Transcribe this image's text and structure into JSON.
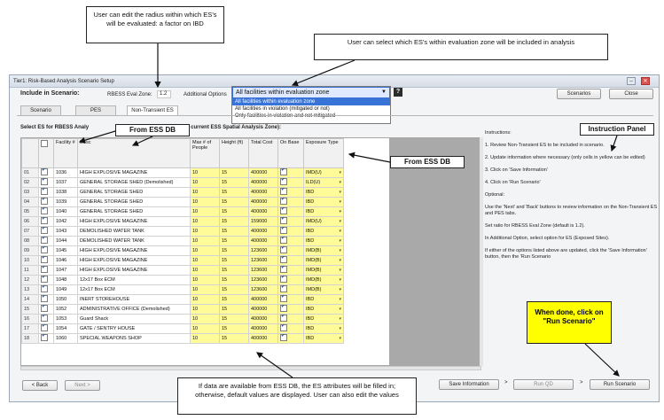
{
  "callouts": {
    "radius": "User can edit the radius within which ES's will be evaluated: a factor on IBD",
    "select_es": "User can select which ES's within evaluation zone will be included in analysis",
    "instruction_panel": "Instruction Panel",
    "from_ess_db_1": "From ESS DB",
    "from_ess_db_2": "From ESS DB",
    "defaults": "If data are available from ESS DB, the ES attributes will be filled in; otherwise, default values are displayed. User can also edit the values",
    "run": "When done, click on \"Run Scenario\""
  },
  "window": {
    "title": "Tier1: Risk-Based Analysis Scenario Setup",
    "include_label": "Include in Scenario:",
    "eval_zone_label": "RBESS Eval Zone:",
    "eval_zone_value": "1.2",
    "additional_options_label": "Additional Options",
    "help_icon": "?",
    "scenarios_button": "Scenarios",
    "close_button": "Close"
  },
  "dropdown": {
    "selected": "All facilities within evaluation zone",
    "options": [
      "All facilities within evaluation zone",
      "All facilities in violation (mitigated or not)",
      "Only facilities in violation and not mitigated"
    ]
  },
  "tabs": [
    "Scenario",
    "PES",
    "Non-Transient ES"
  ],
  "grid": {
    "select_text": "Select ES for RBESS Analy",
    "select_text_tail": "listed below from current ESS Spatial Analysis Zone):",
    "headers": [
      "",
      "Facility #",
      "Desc",
      "Max # of People",
      "Height (ft)",
      "Total Cost",
      "On Base",
      "Exposure Type"
    ],
    "rows": [
      {
        "n": "01",
        "fac": "1036",
        "desc": "HIGH EXPLOSIVE MAGAZINE",
        "people": "10",
        "height": "15",
        "cost": "400000",
        "exp": "IMD(U)"
      },
      {
        "n": "02",
        "fac": "1037",
        "desc": "GENERAL STORAGE SHED (Demolished)",
        "people": "10",
        "height": "15",
        "cost": "400000",
        "exp": "ILD(U)"
      },
      {
        "n": "03",
        "fac": "1038",
        "desc": "GENERAL STORAGE SHED",
        "people": "10",
        "height": "15",
        "cost": "400000",
        "exp": "IBD"
      },
      {
        "n": "04",
        "fac": "1039",
        "desc": "GENERAL STORAGE SHED",
        "people": "10",
        "height": "15",
        "cost": "400000",
        "exp": "IBD"
      },
      {
        "n": "05",
        "fac": "1040",
        "desc": "GENERAL STORAGE SHED",
        "people": "10",
        "height": "15",
        "cost": "400000",
        "exp": "IBD"
      },
      {
        "n": "06",
        "fac": "1042",
        "desc": "HIGH EXPLOSIVE MAGAZINE",
        "people": "10",
        "height": "15",
        "cost": "159000",
        "exp": "IMD(U)"
      },
      {
        "n": "07",
        "fac": "1043",
        "desc": "DEMOLISHED WATER TANK",
        "people": "10",
        "height": "15",
        "cost": "400000",
        "exp": "IBD"
      },
      {
        "n": "08",
        "fac": "1044",
        "desc": "DEMOLISHED WATER TANK",
        "people": "10",
        "height": "15",
        "cost": "400000",
        "exp": "IBD"
      },
      {
        "n": "09",
        "fac": "1045",
        "desc": "HIGH EXPLOSIVE MAGAZINE",
        "people": "10",
        "height": "15",
        "cost": "123600",
        "exp": "IMD(B)"
      },
      {
        "n": "10",
        "fac": "1046",
        "desc": "HIGH EXPLOSIVE MAGAZINE",
        "people": "10",
        "height": "15",
        "cost": "123600",
        "exp": "IMD(B)"
      },
      {
        "n": "11",
        "fac": "1047",
        "desc": "HIGH EXPLOSIVE MAGAZINE",
        "people": "10",
        "height": "15",
        "cost": "123600",
        "exp": "IMD(B)"
      },
      {
        "n": "12",
        "fac": "1048",
        "desc": "12x17 Box ECM",
        "people": "10",
        "height": "15",
        "cost": "123600",
        "exp": "IMD(B)"
      },
      {
        "n": "13",
        "fac": "1049",
        "desc": "12x17 Box ECM",
        "people": "10",
        "height": "15",
        "cost": "123600",
        "exp": "IMD(B)"
      },
      {
        "n": "14",
        "fac": "1050",
        "desc": "INERT STOREHOUSE",
        "people": "10",
        "height": "15",
        "cost": "400000",
        "exp": "IBD"
      },
      {
        "n": "15",
        "fac": "1052",
        "desc": "ADMINISTRATIVE OFFICE (Demolished)",
        "people": "10",
        "height": "15",
        "cost": "400000",
        "exp": "IBD"
      },
      {
        "n": "16",
        "fac": "1053",
        "desc": "Guard Shack",
        "people": "10",
        "height": "15",
        "cost": "400000",
        "exp": "IBD"
      },
      {
        "n": "17",
        "fac": "1054",
        "desc": "GATE / SENTRY HOUSE",
        "people": "10",
        "height": "15",
        "cost": "400000",
        "exp": "IBD"
      },
      {
        "n": "18",
        "fac": "1060",
        "desc": "SPECIAL WEAPONS SHOP",
        "people": "10",
        "height": "15",
        "cost": "400000",
        "exp": "IBD"
      }
    ]
  },
  "instructions": {
    "title": "Instructions:",
    "items": [
      "1. Review Non-Transient ES to be included in scenario.",
      "2. Update information where necessary (only cells in yellow can be edited)",
      "3. Click on 'Save Information'",
      "4. Click on 'Run Scenario'",
      "Optional:",
      "Use the 'Next' and 'Back' buttons to review information on the Non-Transient ES and PES tabs.",
      "Set ratio for RBESS Eval Zone (default is 1.2).",
      "In Additional Option, select option for ES (Exposed Sites).",
      "If either of the options listed above are updated, click the 'Save Information' button, then the 'Run Scenario"
    ]
  },
  "footer": {
    "back": "< Back",
    "next": "Next >",
    "save": "Save Information",
    "run_qd": "Run QD",
    "run_scenario": "Run Scenario",
    "sep1": ">",
    "sep2": ">"
  }
}
